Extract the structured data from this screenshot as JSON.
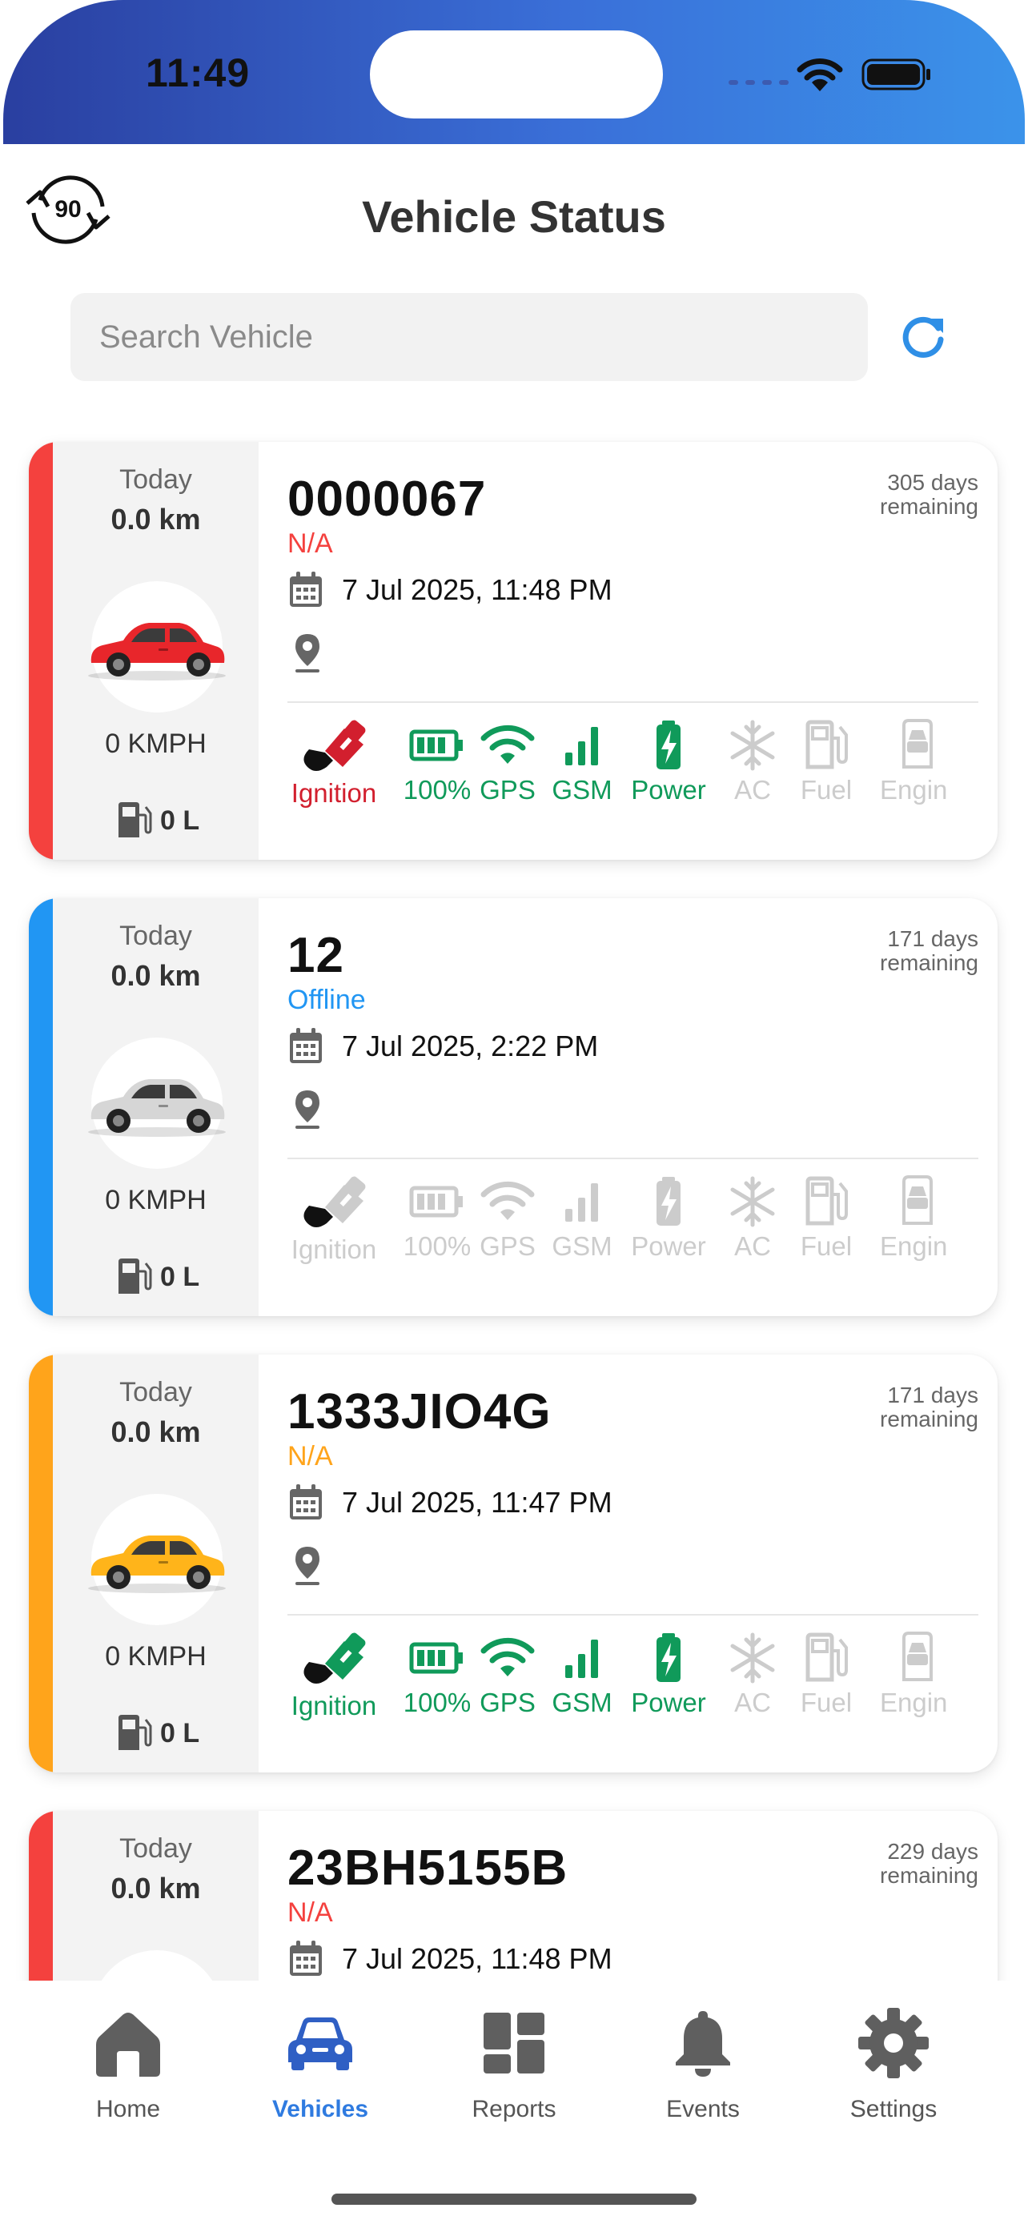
{
  "status_bar": {
    "time": "11:49"
  },
  "header": {
    "title": "Vehicle Status",
    "logo_text": "90"
  },
  "search": {
    "placeholder": "Search Vehicle",
    "value": ""
  },
  "colors": {
    "red": "#f4413e",
    "blue": "#2196f3",
    "orange": "#ffa41b",
    "active_green": "#109a5a",
    "active_red": "#d21f2e",
    "inactive": "#cccccc",
    "accent": "#2f7be0"
  },
  "vehicles": [
    {
      "name": "0000067",
      "status": "N/A",
      "status_color": "#f4413e",
      "stripe_color": "#f4413e",
      "car_color": "#e8262b",
      "days": "305 days remaining",
      "today_label": "Today",
      "km": "0.0 km",
      "speed": "0 KMPH",
      "fuel": "0 L",
      "datetime": "7 Jul 2025, 11:48 PM",
      "indicators": {
        "ignition": {
          "label": "Ignition",
          "color": "#d21f2e"
        },
        "battery": {
          "label": "100%",
          "color": "#109a5a"
        },
        "gps": {
          "label": "GPS",
          "color": "#109a5a"
        },
        "gsm": {
          "label": "GSM",
          "color": "#109a5a"
        },
        "power": {
          "label": "Power",
          "color": "#109a5a"
        },
        "ac": {
          "label": "AC",
          "color": "#cccccc"
        },
        "fuel": {
          "label": "Fuel",
          "color": "#cccccc"
        },
        "engine": {
          "label": "Engin",
          "color": "#cccccc"
        }
      }
    },
    {
      "name": "12",
      "status": "Offline",
      "status_color": "#2196f3",
      "stripe_color": "#2196f3",
      "car_color": "#d6d6d6",
      "days": "171 days remaining",
      "today_label": "Today",
      "km": "0.0 km",
      "speed": "0 KMPH",
      "fuel": "0 L",
      "datetime": "7 Jul 2025, 2:22 PM",
      "indicators": {
        "ignition": {
          "label": "Ignition",
          "color": "#cccccc"
        },
        "battery": {
          "label": "100%",
          "color": "#cccccc"
        },
        "gps": {
          "label": "GPS",
          "color": "#cccccc"
        },
        "gsm": {
          "label": "GSM",
          "color": "#cccccc"
        },
        "power": {
          "label": "Power",
          "color": "#cccccc"
        },
        "ac": {
          "label": "AC",
          "color": "#cccccc"
        },
        "fuel": {
          "label": "Fuel",
          "color": "#cccccc"
        },
        "engine": {
          "label": "Engin",
          "color": "#cccccc"
        }
      }
    },
    {
      "name": "1333JIO4G",
      "status": "N/A",
      "status_color": "#ffa41b",
      "stripe_color": "#ffa41b",
      "car_color": "#ffb41a",
      "days": "171 days remaining",
      "today_label": "Today",
      "km": "0.0 km",
      "speed": "0 KMPH",
      "fuel": "0 L",
      "datetime": "7 Jul 2025, 11:47 PM",
      "indicators": {
        "ignition": {
          "label": "Ignition",
          "color": "#109a5a"
        },
        "battery": {
          "label": "100%",
          "color": "#109a5a"
        },
        "gps": {
          "label": "GPS",
          "color": "#109a5a"
        },
        "gsm": {
          "label": "GSM",
          "color": "#109a5a"
        },
        "power": {
          "label": "Power",
          "color": "#109a5a"
        },
        "ac": {
          "label": "AC",
          "color": "#cccccc"
        },
        "fuel": {
          "label": "Fuel",
          "color": "#cccccc"
        },
        "engine": {
          "label": "Engin",
          "color": "#cccccc"
        }
      }
    },
    {
      "name": "23BH5155B",
      "status": "N/A",
      "status_color": "#f4413e",
      "stripe_color": "#f4413e",
      "car_color": "#e8262b",
      "days": "229 days remaining",
      "today_label": "Today",
      "km": "0.0 km",
      "speed": "",
      "fuel": "",
      "datetime": "7 Jul 2025, 11:48 PM",
      "indicators": null
    }
  ],
  "bottom_nav": [
    {
      "label": "Home",
      "icon": "home-icon",
      "active": false
    },
    {
      "label": "Vehicles",
      "icon": "car-icon",
      "active": true
    },
    {
      "label": "Reports",
      "icon": "dashboard-icon",
      "active": false
    },
    {
      "label": "Events",
      "icon": "bell-icon",
      "active": false
    },
    {
      "label": "Settings",
      "icon": "gear-icon",
      "active": false
    }
  ]
}
